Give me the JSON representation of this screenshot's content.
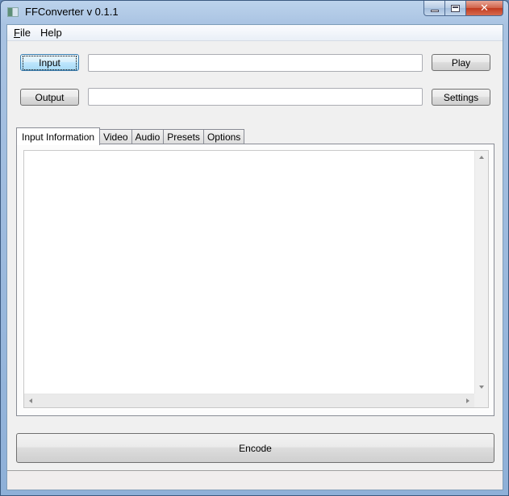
{
  "window": {
    "title": "FFConverter v 0.1.1",
    "icon": "app-icon",
    "caption_buttons": {
      "minimize": "minimize-icon",
      "maximize": "maximize-icon",
      "close": "close-icon",
      "close_glyph": "✕"
    }
  },
  "menubar": {
    "items": [
      {
        "label_underlined": "F",
        "label_rest": "ile"
      },
      {
        "label": "Help"
      }
    ]
  },
  "io": {
    "input_button": "Input",
    "input_path": "",
    "output_button": "Output",
    "output_path": "",
    "play_button": "Play",
    "settings_button": "Settings"
  },
  "tabs": [
    {
      "label": "Input Information",
      "active": true
    },
    {
      "label": "Video",
      "active": false
    },
    {
      "label": "Audio",
      "active": false
    },
    {
      "label": "Presets",
      "active": false
    },
    {
      "label": "Options",
      "active": false
    }
  ],
  "input_information": {
    "text": ""
  },
  "encode_button": "Encode",
  "status_bar": {
    "text": ""
  },
  "colors": {
    "titlebar": "#a9c3e2",
    "close_button": "#c13a1f",
    "focus_button": "#bee6fd",
    "background": "#f0f0f0"
  }
}
